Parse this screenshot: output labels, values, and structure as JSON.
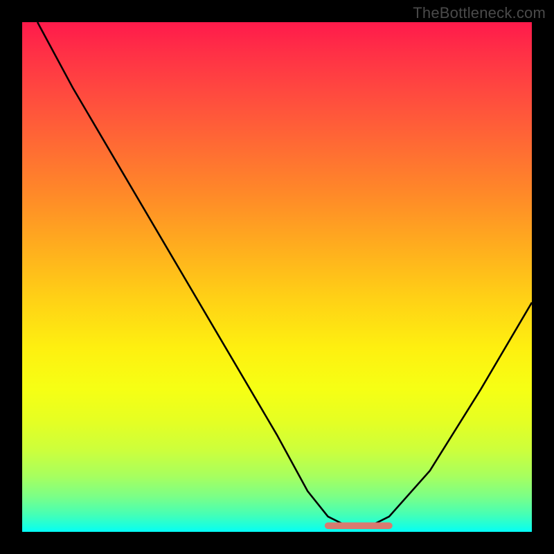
{
  "watermark": "TheBottleneck.com",
  "colors": {
    "background": "#000000",
    "curve": "#000000",
    "accent": "#d97a6f"
  },
  "chart_data": {
    "type": "line",
    "title": "",
    "xlabel": "",
    "ylabel": "",
    "xlim": [
      0,
      100
    ],
    "ylim": [
      0,
      100
    ],
    "grid": false,
    "legend": false,
    "series": [
      {
        "name": "bottleneck-curve",
        "x": [
          3,
          10,
          20,
          30,
          40,
          50,
          56,
          60,
          64,
          68,
          72,
          80,
          90,
          100
        ],
        "y": [
          100,
          87,
          70,
          53,
          36,
          19,
          8,
          3,
          1,
          1,
          3,
          12,
          28,
          45
        ]
      }
    ],
    "annotations": [
      {
        "name": "optimal-range-marker",
        "type": "segment",
        "x0": 60,
        "x1": 72,
        "y": 1.2,
        "color": "#d97a6f"
      }
    ],
    "gradient_stops": [
      {
        "pos": 0.0,
        "color": "#ff1a4b"
      },
      {
        "pos": 0.5,
        "color": "#ffd016"
      },
      {
        "pos": 0.75,
        "color": "#e6ff22"
      },
      {
        "pos": 1.0,
        "color": "#02fff8"
      }
    ]
  }
}
